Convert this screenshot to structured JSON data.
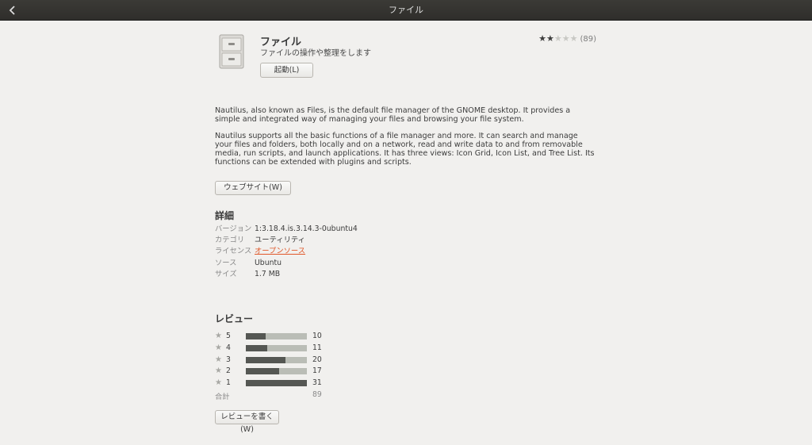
{
  "header": {
    "back_icon": "chevron-left-icon",
    "title": "ファイル"
  },
  "app": {
    "icon": "file-cabinet-icon",
    "name": "ファイル",
    "summary": "ファイルの操作や整理をします",
    "rating_stars": 2,
    "rating_max": 5,
    "rating_count": "(89)",
    "launch_label": "起動(L)"
  },
  "description": {
    "p1": "Nautilus, also known as Files, is the default file manager of the GNOME desktop. It provides a simple and integrated way of managing your files and browsing your file system.",
    "p2": "Nautilus supports all the basic functions of a file manager and more. It can search and manage your files and folders, both locally and on a network, read and write data to and from removable media, run scripts, and launch applications. It has three views: Icon Grid, Icon List, and Tree List. Its functions can be extended with plugins and scripts."
  },
  "website_label": "ウェブサイト(W)",
  "details": {
    "title": "詳細",
    "rows": [
      {
        "key": "バージョン",
        "value": "1:3.18.4.is.3.14.3-0ubuntu4"
      },
      {
        "key": "カテゴリ",
        "value": "ユーティリティ"
      },
      {
        "key": "ライセンス",
        "value": "オープンソース"
      },
      {
        "key": "ソース",
        "value": "Ubuntu"
      },
      {
        "key": "サイズ",
        "value": "1.7 MB"
      }
    ]
  },
  "reviews": {
    "title": "レビュー",
    "rows": [
      {
        "stars": "5",
        "count": "10",
        "fraction": 0.32
      },
      {
        "stars": "4",
        "count": "11",
        "fraction": 0.35
      },
      {
        "stars": "3",
        "count": "20",
        "fraction": 0.65
      },
      {
        "stars": "2",
        "count": "17",
        "fraction": 0.55
      },
      {
        "stars": "1",
        "count": "31",
        "fraction": 1.0
      }
    ],
    "total_label": "合計",
    "total_value": "89",
    "write_label": "レビューを書く(W)"
  },
  "colors": {
    "header_bg": "#33322f",
    "bar_fill": "#555753",
    "bar_track": "#babdb6",
    "link": "#e0582a"
  }
}
